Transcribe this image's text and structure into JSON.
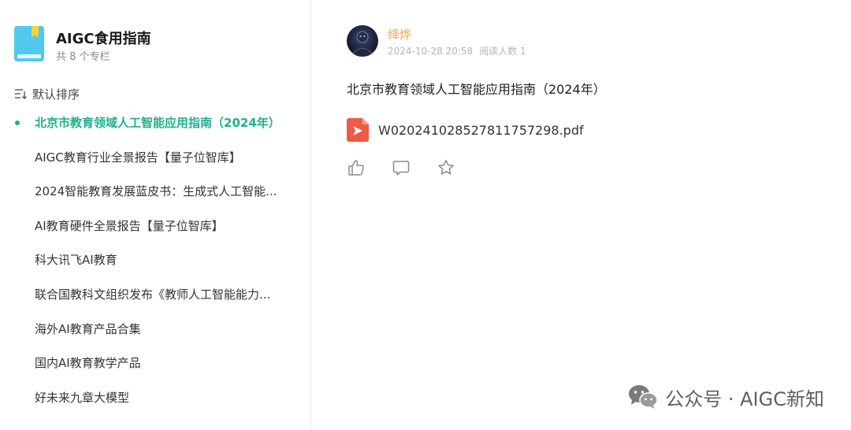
{
  "sidebar": {
    "book": {
      "title": "AIGC食用指南",
      "count": "共 8 个专栏"
    },
    "sort_label": "默认排序",
    "articles": [
      {
        "title": "北京市教育领域人工智能应用指南（2024年）",
        "active": true
      },
      {
        "title": "AIGC教育行业全景报告【量子位智库】"
      },
      {
        "title": "2024智能教育发展蓝皮书：生成式人工智能..."
      },
      {
        "title": "AI教育硬件全景报告【量子位智库】"
      },
      {
        "title": "科大讯飞AI教育"
      },
      {
        "title": "联合国教科文组织发布《教师人工智能能力..."
      },
      {
        "title": "海外AI教育产品合集"
      },
      {
        "title": "国内AI教育教学产品"
      },
      {
        "title": "好未来九章大模型"
      }
    ]
  },
  "post": {
    "author": "绛烨",
    "datetime": "2024-10-28 20:58",
    "readers": "阅读人数 1",
    "text": "北京市教育领域人工智能应用指南（2024年）",
    "attachment": {
      "filename": "W020241028527811757298.pdf",
      "icon": "pdf-icon"
    },
    "actions": [
      "like-icon",
      "comment-icon",
      "favorite-icon"
    ]
  },
  "watermark": {
    "text": "公众号 · AIGC新知",
    "icon": "wechat-icon"
  },
  "colors": {
    "accent": "#1eb08f",
    "author": "#f3a54a",
    "book_icon": "#51c8ee",
    "bookmark": "#f5d23a",
    "pdf": "#ee5a44"
  }
}
